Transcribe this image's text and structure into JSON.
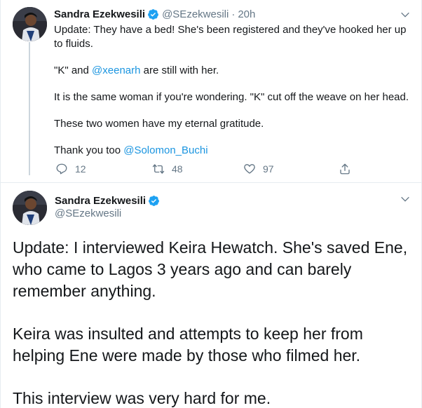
{
  "tweet1": {
    "author": {
      "name": "Sandra Ezekwesili",
      "handle": "@SEzekwesili",
      "separator": "·",
      "time": "20h"
    },
    "body": {
      "line1": "Update: They have a bed! She's been registered and they've hooked her up to fluids.",
      "line2_prefix": "\"K\" and ",
      "line2_mention": "@xeenarh",
      "line2_suffix": " are still with her.",
      "line3": "It is the same woman if you're wondering. \"K\" cut off the weave on her head.",
      "line4": "These two women have my eternal gratitude.",
      "line5_prefix": "Thank you too ",
      "line5_mention": "@Solomon_Buchi"
    },
    "actions": {
      "replies": "12",
      "retweets": "48",
      "likes": "97"
    }
  },
  "tweet2": {
    "author": {
      "name": "Sandra Ezekwesili",
      "handle": "@SEzekwesili"
    },
    "body": {
      "para1": "Update: I interviewed Keira Hewatch. She's saved Ene, who came to Lagos 3 years ago and can barely remember anything.",
      "para2": "Keira was insulted and attempts to keep her from helping Ene were made by those who filmed her.",
      "para3": "This interview was very hard for me."
    }
  },
  "colors": {
    "link": "#1b95e0",
    "secondary_text": "#657786",
    "primary_text": "#14171a",
    "verified_badge": "#1da1f2",
    "divider": "#e6ecf0"
  },
  "icons": [
    "verified-badge-icon",
    "chevron-down-icon",
    "reply-icon",
    "retweet-icon",
    "like-icon",
    "share-icon"
  ]
}
